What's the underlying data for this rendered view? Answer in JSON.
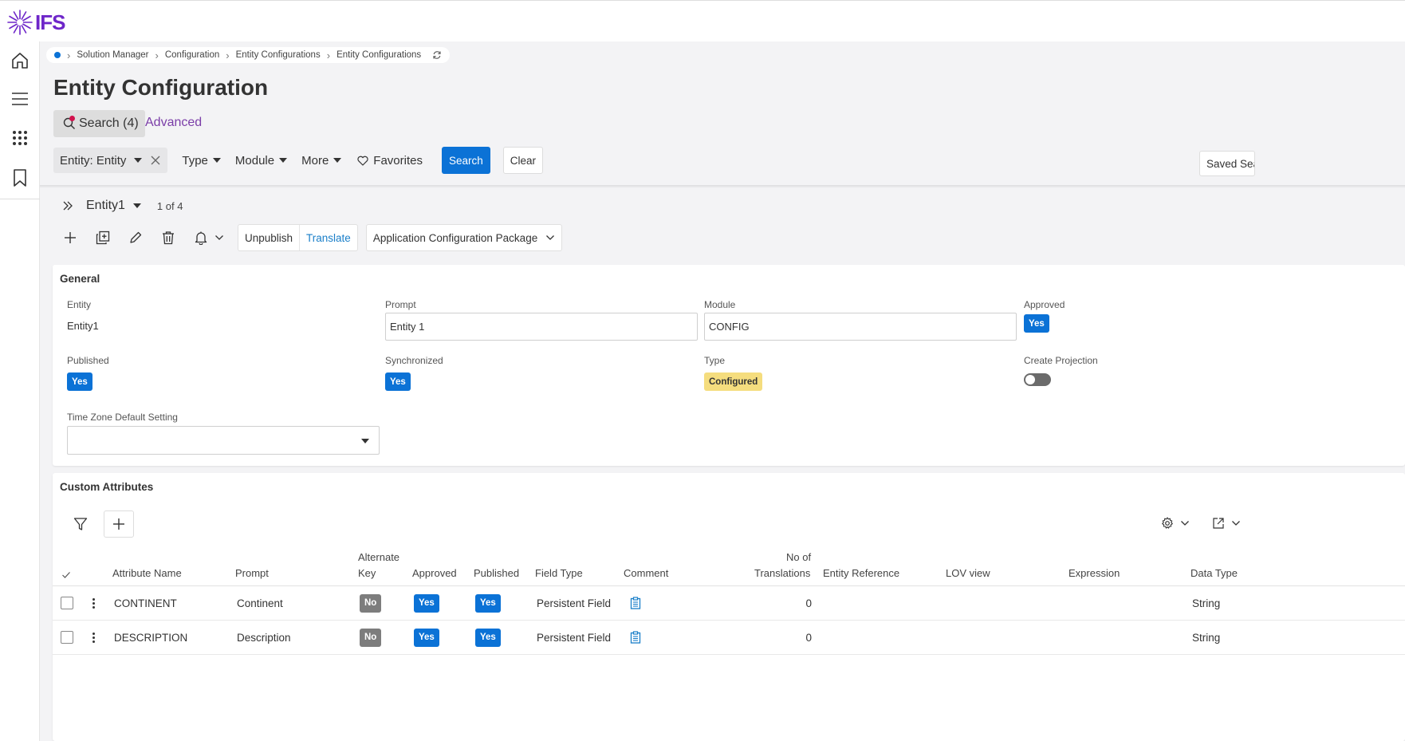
{
  "app": {
    "logo_text": "IFS"
  },
  "breadcrumb": {
    "items": [
      "Solution Manager",
      "Configuration",
      "Entity Configurations",
      "Entity Configurations"
    ]
  },
  "page": {
    "title": "Entity Configuration",
    "search_tab": "Search (4)",
    "advanced_tab": "Advanced"
  },
  "filters": {
    "entity_chip": "Entity: Entity",
    "dropdowns": [
      "Type",
      "Module",
      "More"
    ],
    "favorites": "Favorites",
    "search_button": "Search",
    "clear_button": "Clear",
    "saved_search": "Saved Searches"
  },
  "record_nav": {
    "name": "Entity1",
    "count": "1 of 4"
  },
  "toolbar": {
    "unpublish": "Unpublish",
    "translate": "Translate",
    "package": "Application Configuration Package"
  },
  "general": {
    "title": "General",
    "entity_label": "Entity",
    "entity_value": "Entity1",
    "prompt_label": "Prompt",
    "prompt_value": "Entity 1",
    "module_label": "Module",
    "module_value": "CONFIG",
    "approved_label": "Approved",
    "approved_value": "Yes",
    "published_label": "Published",
    "published_value": "Yes",
    "synchronized_label": "Synchronized",
    "synchronized_value": "Yes",
    "type_label": "Type",
    "type_value": "Configured",
    "create_projection_label": "Create Projection",
    "create_projection_on": false,
    "timezone_label": "Time Zone Default Setting",
    "timezone_value": ""
  },
  "attributes": {
    "title": "Custom Attributes",
    "columns": {
      "attribute_name": "Attribute Name",
      "prompt": "Prompt",
      "alternate_key_1": "Alternate",
      "alternate_key_2": "Key",
      "approved": "Approved",
      "published": "Published",
      "field_type": "Field Type",
      "comment": "Comment",
      "no_of_1": "No of",
      "no_of_2": "Translations",
      "entity_reference": "Entity Reference",
      "lov_view": "LOV view",
      "expression": "Expression",
      "data_type": "Data Type"
    },
    "rows": [
      {
        "attribute_name": "CONTINENT",
        "prompt": "Continent",
        "alternate_key": "No",
        "approved": "Yes",
        "published": "Yes",
        "field_type": "Persistent Field",
        "translations": "0",
        "data_type": "String"
      },
      {
        "attribute_name": "DESCRIPTION",
        "prompt": "Description",
        "alternate_key": "No",
        "approved": "Yes",
        "published": "Yes",
        "field_type": "Persistent Field",
        "translations": "0",
        "data_type": "String"
      }
    ]
  },
  "colors": {
    "primary_blue": "#0b72d6",
    "brand_purple": "#6e26c9",
    "configured_yellow": "#f5dd7e",
    "no_gray": "#7d7d7d",
    "notification_red": "#d1124d"
  }
}
